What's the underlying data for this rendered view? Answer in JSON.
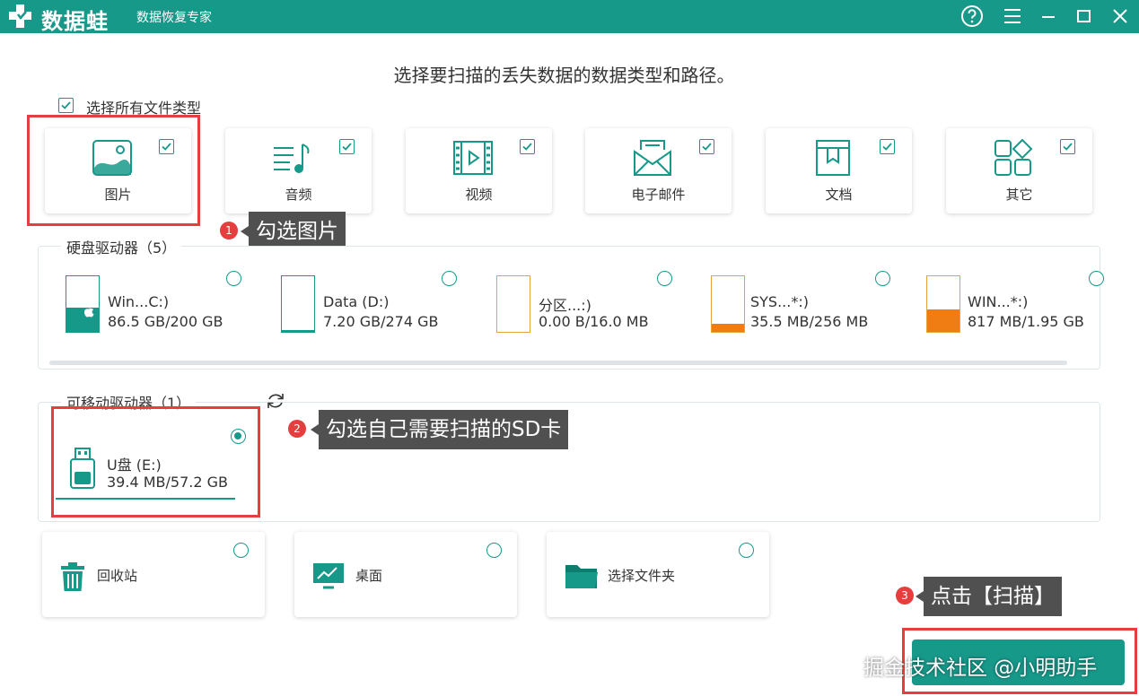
{
  "app": {
    "brand": "数据蛙",
    "subtitle": "数据恢复专家"
  },
  "heading": "选择要扫描的丢失数据的数据类型和路径。",
  "select_all": {
    "label": "选择所有文件类型",
    "checked": true
  },
  "file_types": [
    {
      "label": "图片",
      "icon": "image-icon",
      "checked": true
    },
    {
      "label": "音频",
      "icon": "music-icon",
      "checked": true
    },
    {
      "label": "视频",
      "icon": "video-icon",
      "checked": true
    },
    {
      "label": "电子邮件",
      "icon": "email-icon",
      "checked": true
    },
    {
      "label": "文档",
      "icon": "document-icon",
      "checked": true
    },
    {
      "label": "其它",
      "icon": "other-icon",
      "checked": true
    }
  ],
  "hard_drives": {
    "title": "硬盘驱动器（5）",
    "items": [
      {
        "name": "Win...C:)",
        "size": "86.5 GB/200 GB",
        "used_fraction": 0.43,
        "fill_color": "#17998a",
        "selected": false
      },
      {
        "name": "Data (D:)",
        "size": "7.20 GB/274 GB",
        "used_fraction": 0.03,
        "fill_color": "#17998a",
        "selected": false
      },
      {
        "name": "分区...:)",
        "size": "0.00  B/16.0 MB",
        "used_fraction": 0.0,
        "fill_color": "#e8a33c",
        "selected": false
      },
      {
        "name": "SYS...*:)",
        "size": "35.5 MB/256 MB",
        "used_fraction": 0.14,
        "fill_color": "#f07c14",
        "selected": false
      },
      {
        "name": "WIN...*:)",
        "size": "817 MB/1.95 GB",
        "used_fraction": 0.41,
        "fill_color": "#f07c14",
        "selected": false
      }
    ]
  },
  "removable_drives": {
    "title": "可移动驱动器（1）",
    "items": [
      {
        "name": "U盘 (E:)",
        "size": "39.4 MB/57.2 GB",
        "selected": true
      }
    ]
  },
  "locations": [
    {
      "label": "回收站",
      "icon": "recycle-bin-icon"
    },
    {
      "label": "桌面",
      "icon": "desktop-icon"
    },
    {
      "label": "选择文件夹",
      "icon": "folder-icon"
    }
  ],
  "annotations": [
    {
      "number": "1",
      "text": "勾选图片"
    },
    {
      "number": "2",
      "text": "勾选自己需要扫描的SD卡"
    },
    {
      "number": "3",
      "text": "点击【扫描】"
    }
  ],
  "watermark": "掘金技术社区 @小明助手",
  "colors": {
    "accent": "#17998a",
    "annotation_red": "#e53e3e",
    "orange": "#f07c14"
  }
}
